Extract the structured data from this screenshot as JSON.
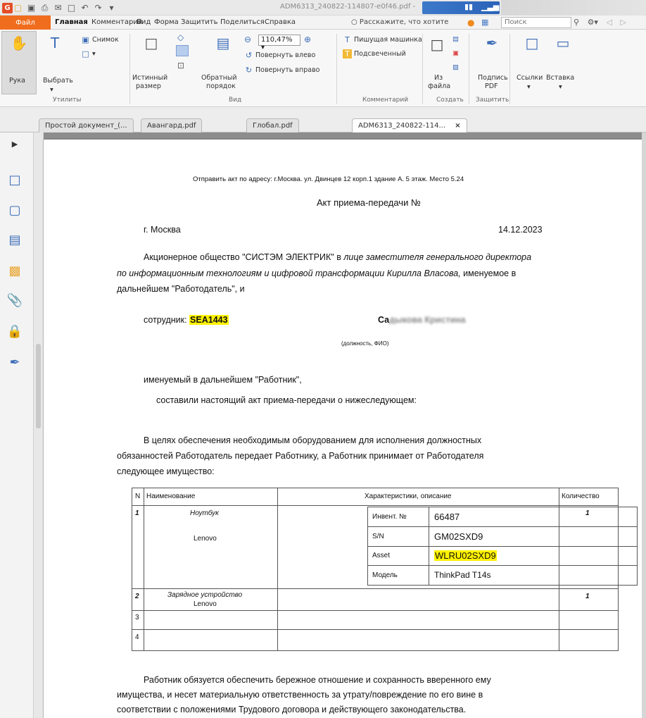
{
  "titlebar": {
    "document_title": "ADM6313_240822-114807-e0f46.pdf -"
  },
  "menu": {
    "file": "Файл",
    "tabs": [
      "Главная",
      "Комментарий",
      "Вид",
      "Форма",
      "Защитить",
      "Поделиться",
      "Справка"
    ],
    "active_tab": "Главная",
    "tell_me": "Расскажите, что хотите",
    "search_placeholder": "Поиск"
  },
  "ribbon": {
    "hand": "Рука",
    "select": "Выбрать",
    "snapshot": "Снимок",
    "utilities_group": "Утилиты",
    "actual_size_1": "Истинный",
    "actual_size_2": "размер",
    "reverse_order_1": "Обратный",
    "reverse_order_2": "порядок",
    "zoom_value": "110,47%",
    "rotate_left": "Повернуть влево",
    "rotate_right": "Повернуть вправо",
    "view_group": "Вид",
    "typewriter": "Пишущая машинка",
    "highlighted": "Подсвеченный",
    "comment_group": "Комментарий",
    "from_file_1": "Из",
    "from_file_2": "файла",
    "create_group": "Создать",
    "sign_pdf_1": "Подпись",
    "sign_pdf_2": "PDF",
    "protect_group": "Защитить",
    "links": "Ссылки",
    "insert": "Вставка"
  },
  "doc_tabs": [
    {
      "label": "Простой документ_(..."
    },
    {
      "label": "Авангард.pdf"
    },
    {
      "label": "Глобал.pdf"
    },
    {
      "label": "ADM6313_240822-114...",
      "close": "×"
    }
  ],
  "document": {
    "send_address": "Отправить акт по адресу: г.Москва. ул. Двинцев 12 корп.1 здание А. 5 этаж. Место 5.24",
    "title": "Акт приема-передачи  №",
    "city": "г. Москва",
    "date": "14.12.2023",
    "intro_normal_1": "Акционерное общество \"СИСТЭМ ЭЛЕКТРИК\" в ",
    "intro_italic_1": "лице заместителя генерального директора",
    "intro_italic_2": "по информационным технологиям и цифровой трансформации Кирилла Власова,",
    "intro_normal_2": " именуемое в",
    "intro_line3": "дальнейшем \"Работодатель\", и",
    "employee_label": "сотрудник: ",
    "employee_id": "SEA1443",
    "employee_name_visible": "Са",
    "employee_name_blurred": "дыкова Кристина",
    "position_note": "(должность, ФИО)",
    "named_worker": "именуемый в дальнейшем \"Работник\",",
    "composed": "составили настоящий акт приема-передачи о нижеследующем:",
    "purpose_1": "В   целях   обеспечения   необходимым   оборудованием   для   исполнения   должностных",
    "purpose_2": "обязанностей  Работодатель  передает  Работнику,  а  Работник  принимает  от  Работодателя",
    "purpose_3": "следующее имущество:",
    "final_1": "Работник  обязуется  обеспечить  бережное  отношение  и  сохранность  вверенного  ему",
    "final_2": "имущества,  и  несет  материальную  ответственность  за  утрату/повреждение  по  его  вине  в",
    "final_3": "соответствии с положениями Трудового договора и действующего законодательства."
  },
  "table": {
    "headers": {
      "n": "N",
      "name": "Наименование",
      "desc": "Характеристики, описание",
      "qty": "Количество"
    },
    "rows": [
      {
        "n": "1",
        "name": "Ноутбук",
        "brand": "Lenovo",
        "qty": "1"
      },
      {
        "n": "2",
        "name": "Зарядное устройство",
        "brand": "Lenovo",
        "qty": "1"
      },
      {
        "n": "3"
      },
      {
        "n": "4"
      }
    ],
    "specs": [
      {
        "label": "Инвент. №",
        "value": "66487"
      },
      {
        "label": "S/N",
        "value": "GM02SXD9"
      },
      {
        "label": "Asset",
        "value": "WLRU02SXD9"
      },
      {
        "label": "Модель",
        "value": "ThinkPad T14s"
      }
    ]
  }
}
